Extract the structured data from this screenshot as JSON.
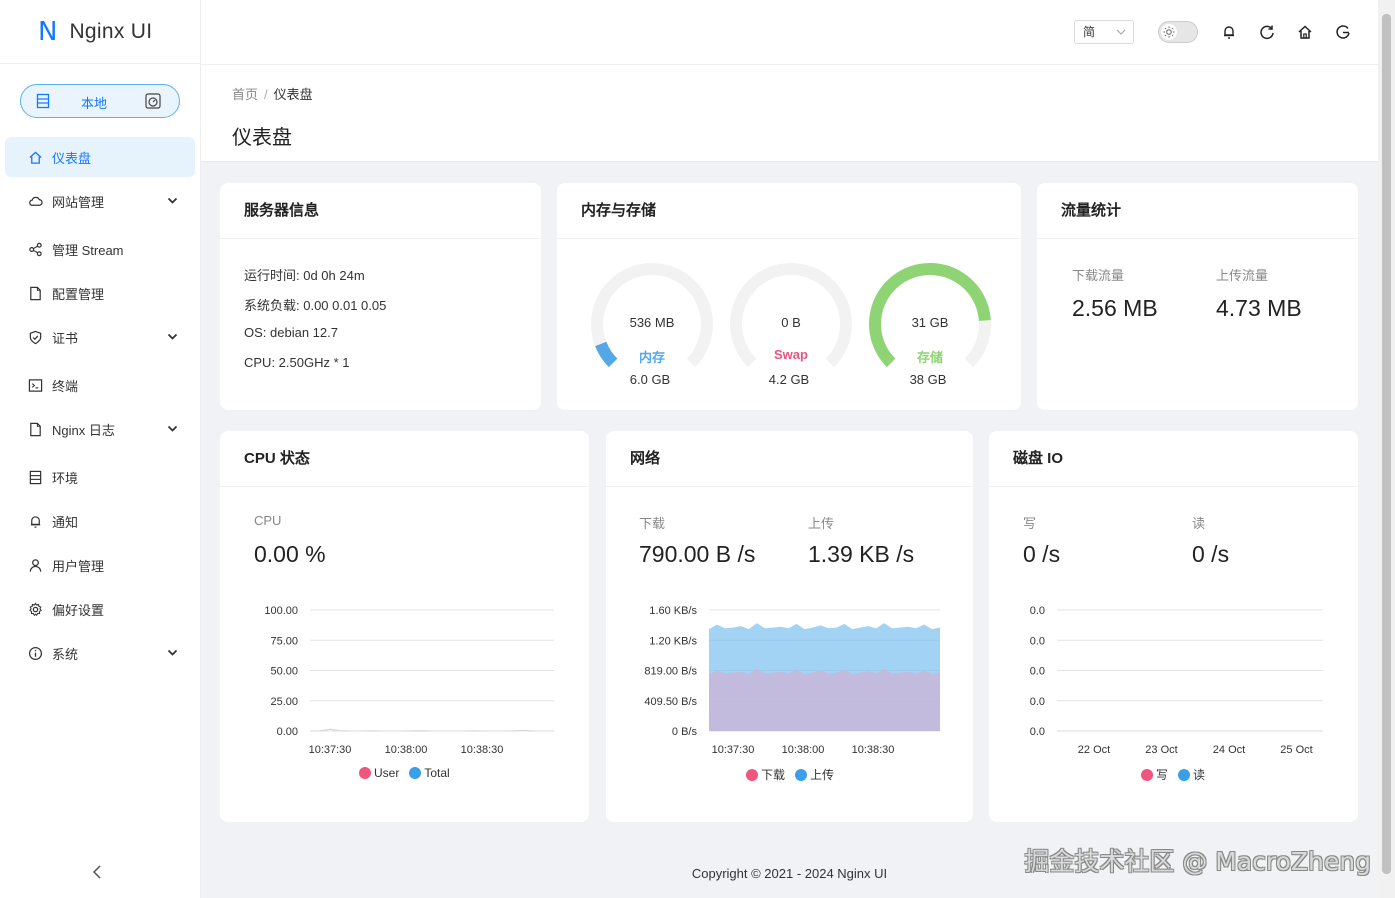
{
  "app": {
    "logo_letter": "N",
    "name": "Nginx UI"
  },
  "env_switch": {
    "label": "本地"
  },
  "sidebar": {
    "items": [
      {
        "label": "仪表盘",
        "icon": "home-icon",
        "active": true,
        "expandable": false
      },
      {
        "label": "网站管理",
        "icon": "cloud-icon",
        "active": false,
        "expandable": true
      },
      {
        "label": "管理 Stream",
        "icon": "share-icon",
        "active": false,
        "expandable": false
      },
      {
        "label": "配置管理",
        "icon": "file-icon",
        "active": false,
        "expandable": false
      },
      {
        "label": "证书",
        "icon": "shield-icon",
        "active": false,
        "expandable": true
      },
      {
        "label": "终端",
        "icon": "terminal-icon",
        "active": false,
        "expandable": false
      },
      {
        "label": "Nginx 日志",
        "icon": "file-icon",
        "active": false,
        "expandable": true
      },
      {
        "label": "环境",
        "icon": "database-icon",
        "active": false,
        "expandable": false
      },
      {
        "label": "通知",
        "icon": "bell-icon",
        "active": false,
        "expandable": false
      },
      {
        "label": "用户管理",
        "icon": "user-icon",
        "active": false,
        "expandable": false
      },
      {
        "label": "偏好设置",
        "icon": "gear-icon",
        "active": false,
        "expandable": false
      },
      {
        "label": "系统",
        "icon": "info-icon",
        "active": false,
        "expandable": true
      }
    ]
  },
  "header": {
    "lang": "简"
  },
  "breadcrumb": {
    "home": "首页",
    "sep": "/",
    "current": "仪表盘"
  },
  "page_title": "仪表盘",
  "server_info": {
    "title": "服务器信息",
    "uptime": "运行时间: 0d 0h 24m",
    "load": "系统负载: 0.00 0.01 0.05",
    "os": "OS: debian 12.7",
    "cpu": "CPU: 2.50GHz * 1"
  },
  "memory": {
    "title": "内存与存储",
    "gauges": [
      {
        "used": "536 MB",
        "name": "内存",
        "total": "6.0 GB",
        "percent": 0.088,
        "color": "#55a8e8"
      },
      {
        "used": "0 B",
        "name": "Swap",
        "total": "4.2 GB",
        "percent": 0.0,
        "color": "#e8557c"
      },
      {
        "used": "31 GB",
        "name": "存储",
        "total": "38 GB",
        "percent": 0.82,
        "color": "#8fd474"
      }
    ]
  },
  "traffic": {
    "title": "流量统计",
    "download_label": "下载流量",
    "download_value": "2.56 MB",
    "upload_label": "上传流量",
    "upload_value": "4.73 MB"
  },
  "cpu_card": {
    "title": "CPU 状态",
    "label": "CPU",
    "value": "0.00 %",
    "legend": [
      "User",
      "Total"
    ]
  },
  "network_card": {
    "title": "网络",
    "down_label": "下载",
    "down_value": "790.00 B /s",
    "up_label": "上传",
    "up_value": "1.39 KB /s",
    "legend": [
      "下载",
      "上传"
    ]
  },
  "disk_card": {
    "title": "磁盘 IO",
    "write_label": "写",
    "write_value": "0 /s",
    "read_label": "读",
    "read_value": "0 /s",
    "legend": [
      "写",
      "读"
    ]
  },
  "chart_data": [
    {
      "type": "line",
      "title": "CPU 状态",
      "x_ticks": [
        "10:37:30",
        "10:38:00",
        "10:38:30"
      ],
      "y_ticks": [
        "100.00",
        "75.00",
        "50.00",
        "25.00",
        "0.00"
      ],
      "ylim": [
        0,
        100
      ],
      "series": [
        {
          "name": "User",
          "color": "#f0557f",
          "values": [
            0,
            0.1,
            1.5,
            0.2,
            0,
            0,
            0.1,
            0,
            0,
            0,
            0.1,
            0.2,
            0,
            0,
            0,
            0,
            0.1,
            0,
            0,
            0,
            0.1,
            0.5,
            0,
            0,
            0
          ]
        },
        {
          "name": "Total",
          "color": "#3a9ee8",
          "values": [
            0,
            0.1,
            1.5,
            0.2,
            0,
            0,
            0.1,
            0,
            0,
            0,
            0.1,
            0.2,
            0,
            0,
            0,
            0,
            0.1,
            0,
            0,
            0,
            0.1,
            0.5,
            0,
            0,
            0
          ]
        }
      ]
    },
    {
      "type": "area",
      "title": "网络",
      "x_ticks": [
        "10:37:30",
        "10:38:00",
        "10:38:30"
      ],
      "y_ticks": [
        "1.60 KB/s",
        "1.20 KB/s",
        "819.00 B/s",
        "409.50 B/s",
        "0 B/s"
      ],
      "ylim": [
        0,
        1638
      ],
      "series": [
        {
          "name": "上传",
          "color": "#7cc0ef",
          "values": [
            1380,
            1440,
            1390,
            1400,
            1420,
            1380,
            1460,
            1390,
            1400,
            1410,
            1390,
            1450,
            1380,
            1400,
            1430,
            1390,
            1400,
            1450,
            1380,
            1400,
            1420,
            1390,
            1460,
            1390,
            1400,
            1410,
            1390,
            1440,
            1380,
            1400
          ]
        },
        {
          "name": "下载",
          "color": "#c8b6d8",
          "values": [
            770,
            820,
            780,
            790,
            800,
            770,
            840,
            780,
            790,
            800,
            780,
            830,
            770,
            790,
            820,
            780,
            790,
            830,
            770,
            790,
            810,
            780,
            840,
            780,
            790,
            800,
            780,
            820,
            770,
            790
          ]
        }
      ]
    },
    {
      "type": "line",
      "title": "磁盘 IO",
      "x_ticks": [
        "22 Oct",
        "23 Oct",
        "24 Oct",
        "25 Oct"
      ],
      "y_ticks": [
        "0.0",
        "0.0",
        "0.0",
        "0.0",
        "0.0"
      ],
      "ylim": [
        0,
        1
      ],
      "series": [
        {
          "name": "写",
          "color": "#f0557f",
          "values": [
            0,
            0,
            0,
            0
          ]
        },
        {
          "name": "读",
          "color": "#3a9ee8",
          "values": [
            0,
            0,
            0,
            0
          ]
        }
      ]
    }
  ],
  "footer": "Copyright © 2021 - 2024 Nginx UI",
  "watermark": "掘金技术社区 @ MacroZheng"
}
